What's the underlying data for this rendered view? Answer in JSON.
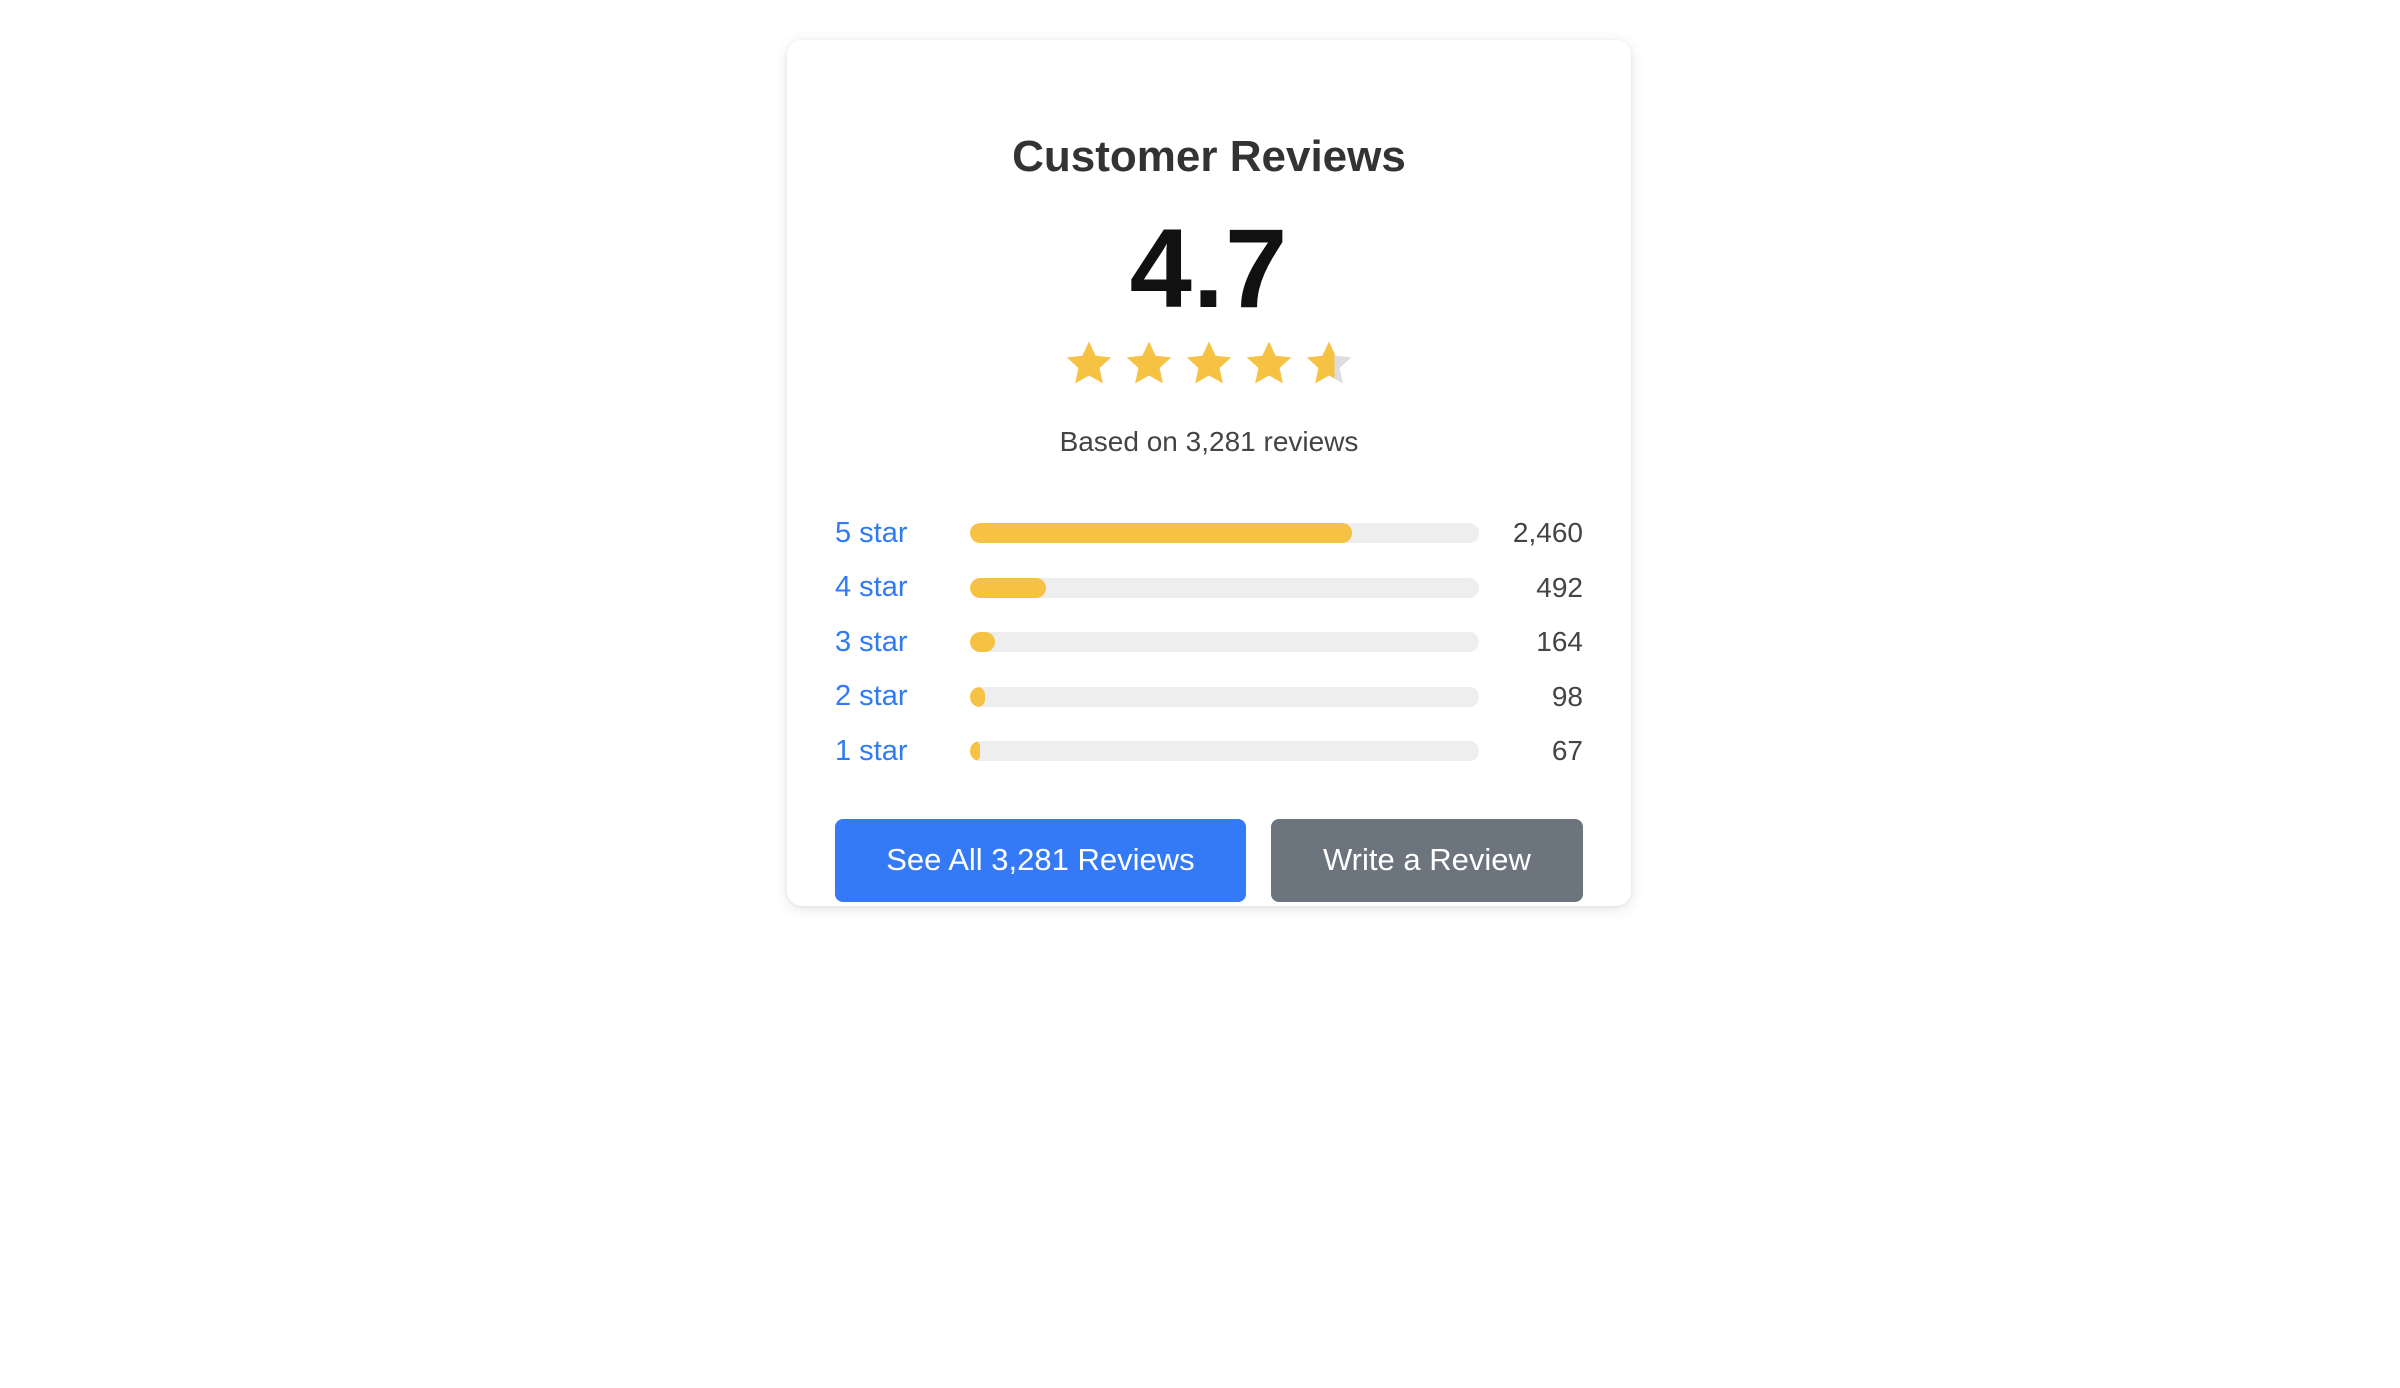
{
  "title": "Customer Reviews",
  "rating": {
    "average": "4.7",
    "average_value": 4.7,
    "max": 5,
    "based_on": "Based on 3,281 reviews"
  },
  "colors": {
    "star": "#f6c244",
    "star_empty": "#dddddd",
    "link": "#2f7bf5",
    "primary": "#3479f5",
    "secondary": "#6c757d",
    "track": "#eeeeee"
  },
  "distribution": [
    {
      "label": "5 star",
      "count": "2,460",
      "value": 2460
    },
    {
      "label": "4 star",
      "count": "492",
      "value": 492
    },
    {
      "label": "3 star",
      "count": "164",
      "value": 164
    },
    {
      "label": "2 star",
      "count": "98",
      "value": 98
    },
    {
      "label": "1 star",
      "count": "67",
      "value": 67
    }
  ],
  "total_reviews": 3281,
  "buttons": {
    "see_all": "See All 3,281 Reviews",
    "write": "Write a Review"
  },
  "icons": [
    "star-icon"
  ]
}
